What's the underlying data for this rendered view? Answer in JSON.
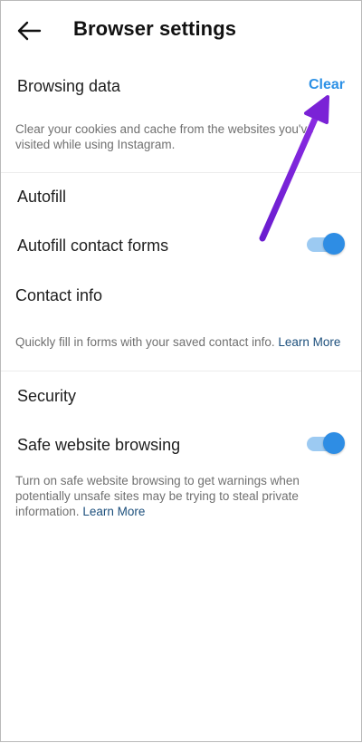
{
  "header": {
    "title": "Browser settings",
    "back_icon": "arrow-left-icon"
  },
  "browsing_data": {
    "title": "Browsing data",
    "clear_label": "Clear",
    "description": "Clear your cookies and cache from the websites you've visited while using Instagram."
  },
  "autofill": {
    "section_title": "Autofill",
    "contact_forms_label": "Autofill contact forms",
    "contact_forms_enabled": true,
    "contact_info_label": "Contact info",
    "description": "Quickly fill in forms with your saved contact info.",
    "learn_more": "Learn More"
  },
  "security": {
    "section_title": "Security",
    "safe_browsing_label": "Safe website browsing",
    "safe_browsing_enabled": true,
    "description": "Turn on safe website browsing to get warnings when potentially unsafe sites may be trying to steal private information.",
    "learn_more": "Learn More"
  },
  "colors": {
    "accent": "#2d91e6",
    "link_dark": "#1c4f7c",
    "toggle_track": "#9ccaf2",
    "toggle_knob": "#2e8de4",
    "annotation_arrow": "#7a22d6"
  }
}
